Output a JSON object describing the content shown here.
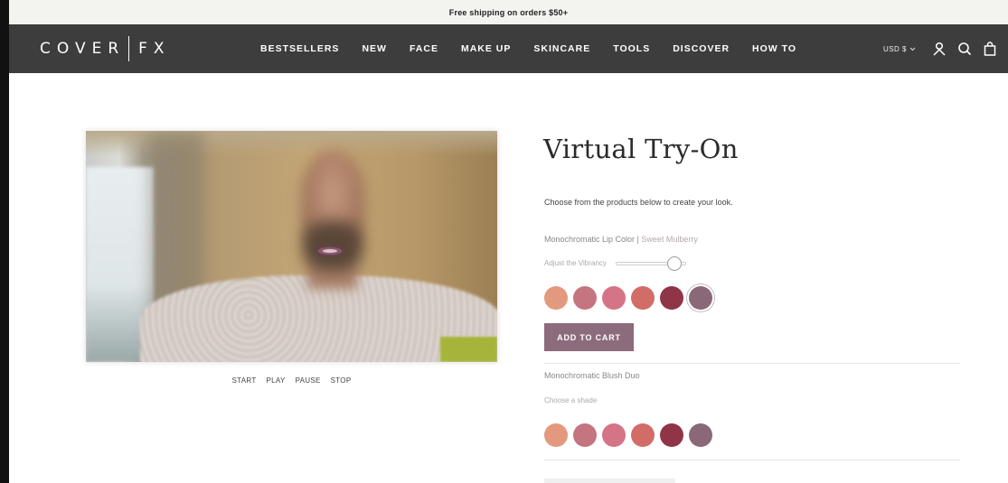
{
  "announcement": {
    "text": "Free shipping on orders $50+"
  },
  "header": {
    "logo_left": "COVER",
    "logo_right": "FX",
    "nav": [
      {
        "label": "BESTSELLERS"
      },
      {
        "label": "NEW"
      },
      {
        "label": "FACE"
      },
      {
        "label": "MAKE UP"
      },
      {
        "label": "SKINCARE"
      },
      {
        "label": "TOOLS"
      },
      {
        "label": "DISCOVER"
      },
      {
        "label": "HOW TO"
      }
    ],
    "currency": "USD $",
    "icons": [
      "user-icon",
      "search-icon",
      "bag-icon"
    ]
  },
  "video": {
    "controls": {
      "start": "START",
      "play": "PLAY",
      "pause": "PAUSE",
      "stop": "STOP"
    }
  },
  "tryon": {
    "title": "Virtual Try-On",
    "intro": "Choose from the products below to create your look.",
    "product1": {
      "name": "Monochromatic Lip Color",
      "separator": " | ",
      "selected_shade": "Sweet Mulberry",
      "vibrancy_label": "Adjust the Vibrancy",
      "vibrancy_value": 0.9,
      "swatches": [
        "#e3997e",
        "#c47580",
        "#d57486",
        "#d16c67",
        "#8f3547",
        "#8b6877"
      ],
      "selected_index": 5,
      "add_to_cart": "ADD TO CART"
    },
    "product2": {
      "name": "Monochromatic Blush Duo",
      "choose_label": "Choose a shade",
      "swatches": [
        "#e3997e",
        "#c47580",
        "#d57486",
        "#d16c67",
        "#8f3547",
        "#8b6877"
      ]
    }
  },
  "colors": {
    "nav_bg": "#3d3d3d",
    "announce_bg": "#f3f3ef",
    "accent": "#8c6b7c"
  }
}
